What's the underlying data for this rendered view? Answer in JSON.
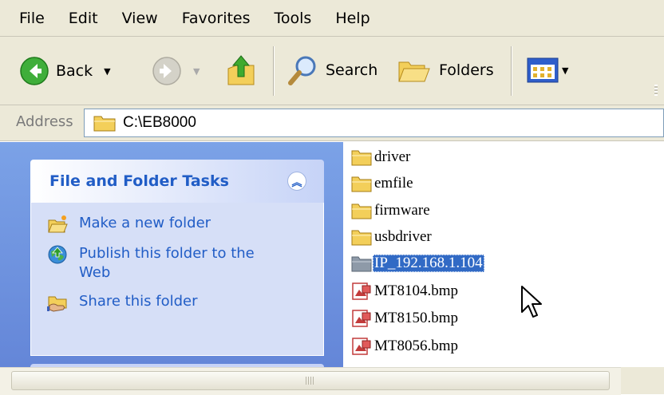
{
  "menu": [
    "File",
    "Edit",
    "View",
    "Favorites",
    "Tools",
    "Help"
  ],
  "toolbar": {
    "back_label": "Back",
    "search_label": "Search",
    "folders_label": "Folders"
  },
  "address": {
    "label": "Address",
    "value": "C:\\EB8000"
  },
  "tasks": {
    "title": "File and Folder Tasks",
    "items": [
      {
        "label": "Make a new folder",
        "icon": "new-folder-icon"
      },
      {
        "label": "Publish this folder to the Web",
        "icon": "publish-web-icon"
      },
      {
        "label": "Share this folder",
        "icon": "share-folder-icon"
      }
    ]
  },
  "files": [
    {
      "name": "driver",
      "type": "folder"
    },
    {
      "name": "emfile",
      "type": "folder"
    },
    {
      "name": "firmware",
      "type": "folder"
    },
    {
      "name": "usbdriver",
      "type": "folder"
    },
    {
      "name": "IP_192.168.1.104",
      "type": "folder",
      "selected": true
    },
    {
      "name": "MT8104.bmp",
      "type": "bitmap"
    },
    {
      "name": "MT8150.bmp",
      "type": "bitmap"
    },
    {
      "name": "MT8056.bmp",
      "type": "bitmap"
    }
  ],
  "colors": {
    "chrome": "#ece9d8",
    "task_link": "#215dc6",
    "selection": "#316ac5",
    "left_pane": "#6f94de"
  }
}
